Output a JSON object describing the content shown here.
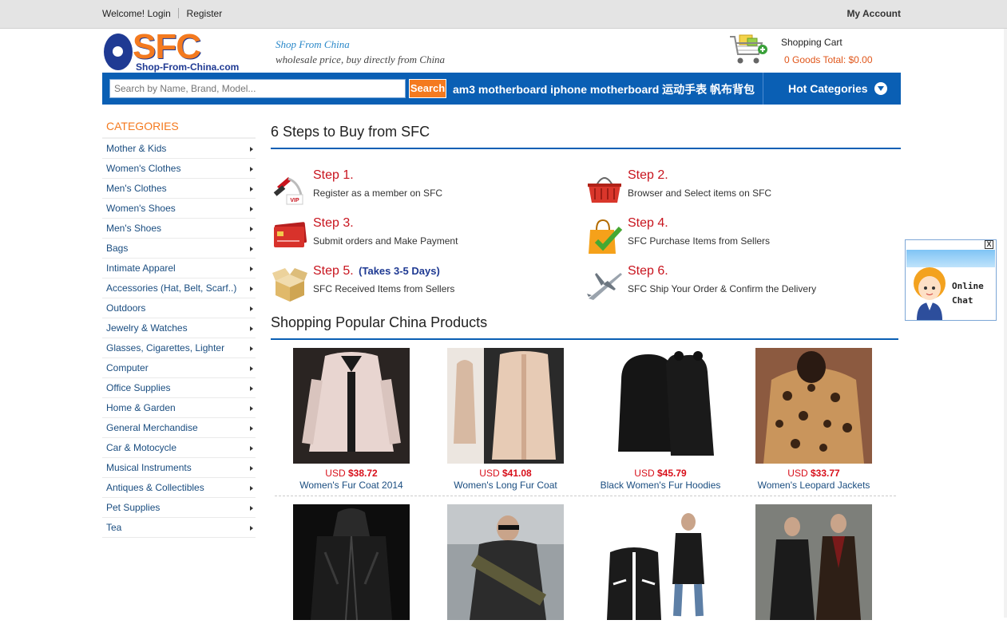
{
  "topbar": {
    "welcome": "Welcome!",
    "login": "Login",
    "register": "Register",
    "my_account": "My Account"
  },
  "logo": {
    "brand": "SFC",
    "url": "Shop-From-China.com"
  },
  "slogan": {
    "line1": "Shop From China",
    "line2": "wholesale price, buy directly from China"
  },
  "cart": {
    "title": "Shopping Cart",
    "summary": "0 Goods Total: $0.00",
    "icon": "shopping-cart-icon"
  },
  "search": {
    "placeholder": "Search by Name, Brand, Model...",
    "button": "Search",
    "hot_keywords": "am3 motherboard iphone motherboard 运动手表 帆布背包"
  },
  "hot_categories": {
    "label": "Hot Categories",
    "icon": "chevron-down-icon"
  },
  "categories": {
    "title": "CATEGORIES",
    "items": [
      "Mother & Kids",
      "Women's Clothes",
      "Men's Clothes",
      "Women's Shoes",
      "Men's Shoes",
      "Bags",
      "Intimate Apparel",
      "Accessories (Hat, Belt, Scarf..)",
      "Outdoors",
      "Jewelry & Watches",
      "Glasses, Cigarettes, Lighter",
      "Computer",
      "Office Supplies",
      "Home & Garden",
      "General Merchandise",
      "Car & Motocycle",
      "Musical Instruments",
      "Antiques & Collectibles",
      "Pet Supplies",
      "Tea"
    ]
  },
  "steps_section": {
    "title": "6 Steps to Buy from SFC",
    "steps": [
      {
        "heading": "Step 1.",
        "note": "",
        "desc": "Register as a member on SFC",
        "icon": "vip-member-icon"
      },
      {
        "heading": "Step 2.",
        "note": "",
        "desc": "Browser and Select items on SFC",
        "icon": "shopping-basket-icon"
      },
      {
        "heading": "Step 3.",
        "note": "",
        "desc": "Submit orders and Make Payment",
        "icon": "credit-card-icon"
      },
      {
        "heading": "Step 4.",
        "note": "",
        "desc": "SFC Purchase Items from Sellers",
        "icon": "shopping-bag-check-icon"
      },
      {
        "heading": "Step 5.",
        "note": "(Takes 3-5 Days)",
        "desc": "SFC Received Items from Sellers",
        "icon": "open-box-icon"
      },
      {
        "heading": "Step 6.",
        "note": "",
        "desc": "SFC Ship Your Order & Confirm the Delivery",
        "icon": "airplane-icon"
      }
    ]
  },
  "products_section": {
    "title": "Shopping Popular China Products",
    "products": [
      {
        "currency": "USD",
        "price": "$38.72",
        "name": "Women's Fur Coat 2014"
      },
      {
        "currency": "USD",
        "price": "$41.08",
        "name": "Women's Long Fur Coat"
      },
      {
        "currency": "USD",
        "price": "$45.79",
        "name": "Black Women's Fur Hoodies"
      },
      {
        "currency": "USD",
        "price": "$33.77",
        "name": "Women's Leopard Jackets"
      },
      {
        "currency": "",
        "price": "",
        "name": ""
      },
      {
        "currency": "",
        "price": "",
        "name": ""
      },
      {
        "currency": "",
        "price": "",
        "name": ""
      },
      {
        "currency": "",
        "price": "",
        "name": ""
      }
    ]
  },
  "chat": {
    "line1": "Online",
    "line2": "Chat",
    "close": "X"
  },
  "colors": {
    "brand_blue": "#0a5fb4",
    "accent_orange": "#f47a1f",
    "price_red": "#d8101b",
    "step_red": "#c8141e"
  }
}
